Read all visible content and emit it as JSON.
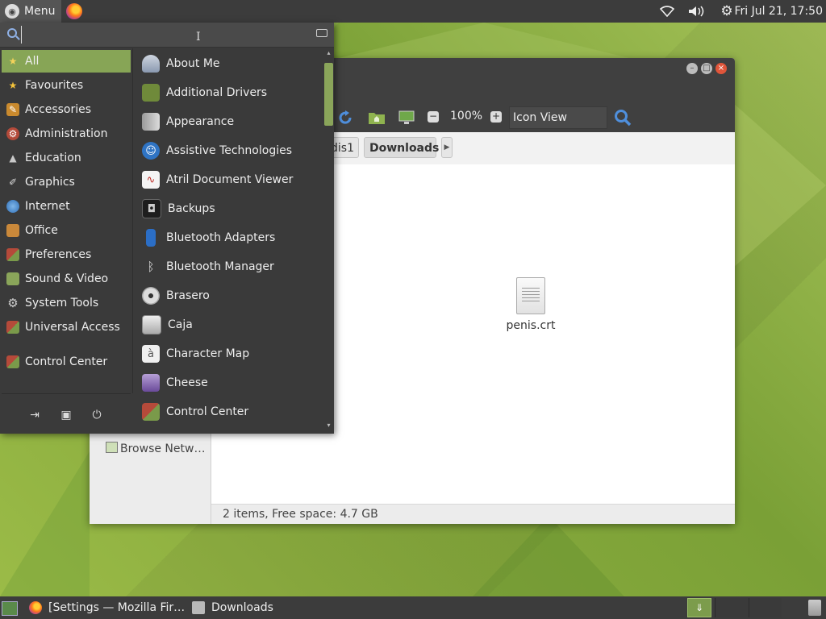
{
  "top_panel": {
    "menu_label": "Menu",
    "clock": "Fri Jul 21, 17:50"
  },
  "menu": {
    "search": {
      "value": "",
      "placeholder": ""
    },
    "categories": [
      {
        "label": "All",
        "icon": "star-icon",
        "selected": true
      },
      {
        "label": "Favourites",
        "icon": "star-icon"
      },
      {
        "label": "Accessories",
        "icon": "accessories-icon"
      },
      {
        "label": "Administration",
        "icon": "administration-icon"
      },
      {
        "label": "Education",
        "icon": "education-icon"
      },
      {
        "label": "Graphics",
        "icon": "graphics-icon"
      },
      {
        "label": "Internet",
        "icon": "globe-icon"
      },
      {
        "label": "Office",
        "icon": "office-icon"
      },
      {
        "label": "Preferences",
        "icon": "preferences-icon"
      },
      {
        "label": "Sound & Video",
        "icon": "sound-video-icon"
      },
      {
        "label": "System Tools",
        "icon": "gear-icon"
      },
      {
        "label": "Universal Access",
        "icon": "universal-access-icon"
      },
      {
        "label": "Control Center",
        "icon": "control-center-icon"
      }
    ],
    "apps": [
      {
        "label": "About Me",
        "icon": "person-icon"
      },
      {
        "label": "Additional Drivers",
        "icon": "drivers-icon"
      },
      {
        "label": "Appearance",
        "icon": "appearance-icon"
      },
      {
        "label": "Assistive Technologies",
        "icon": "accessibility-icon"
      },
      {
        "label": "Atril Document Viewer",
        "icon": "document-viewer-icon"
      },
      {
        "label": "Backups",
        "icon": "backup-icon"
      },
      {
        "label": "Bluetooth Adapters",
        "icon": "bluetooth-adapter-icon"
      },
      {
        "label": "Bluetooth Manager",
        "icon": "bluetooth-icon"
      },
      {
        "label": "Brasero",
        "icon": "disc-icon"
      },
      {
        "label": "Caja",
        "icon": "file-manager-icon"
      },
      {
        "label": "Character Map",
        "icon": "character-map-icon"
      },
      {
        "label": "Cheese",
        "icon": "webcam-icon"
      },
      {
        "label": "Control Center",
        "icon": "control-center-icon"
      }
    ]
  },
  "file_manager": {
    "zoom": "100%",
    "view_mode": "Icon View",
    "breadcrumbs": [
      "dis1",
      "Downloads"
    ],
    "sidebar_item": "Browse Netw…",
    "files": [
      {
        "name": "penis.crt",
        "icon": "document-icon"
      }
    ],
    "status": "2 items, Free space: 4.7 GB"
  },
  "taskbar": {
    "tasks": [
      {
        "label": "[Settings — Mozilla Fir…",
        "icon": "firefox-icon"
      },
      {
        "label": "Downloads",
        "icon": "folder-icon"
      }
    ]
  },
  "colors": {
    "panel": "#3c3c3c",
    "menu_bg": "#3a3a3a",
    "accent": "#87a556",
    "close_button": "#e0553a"
  }
}
